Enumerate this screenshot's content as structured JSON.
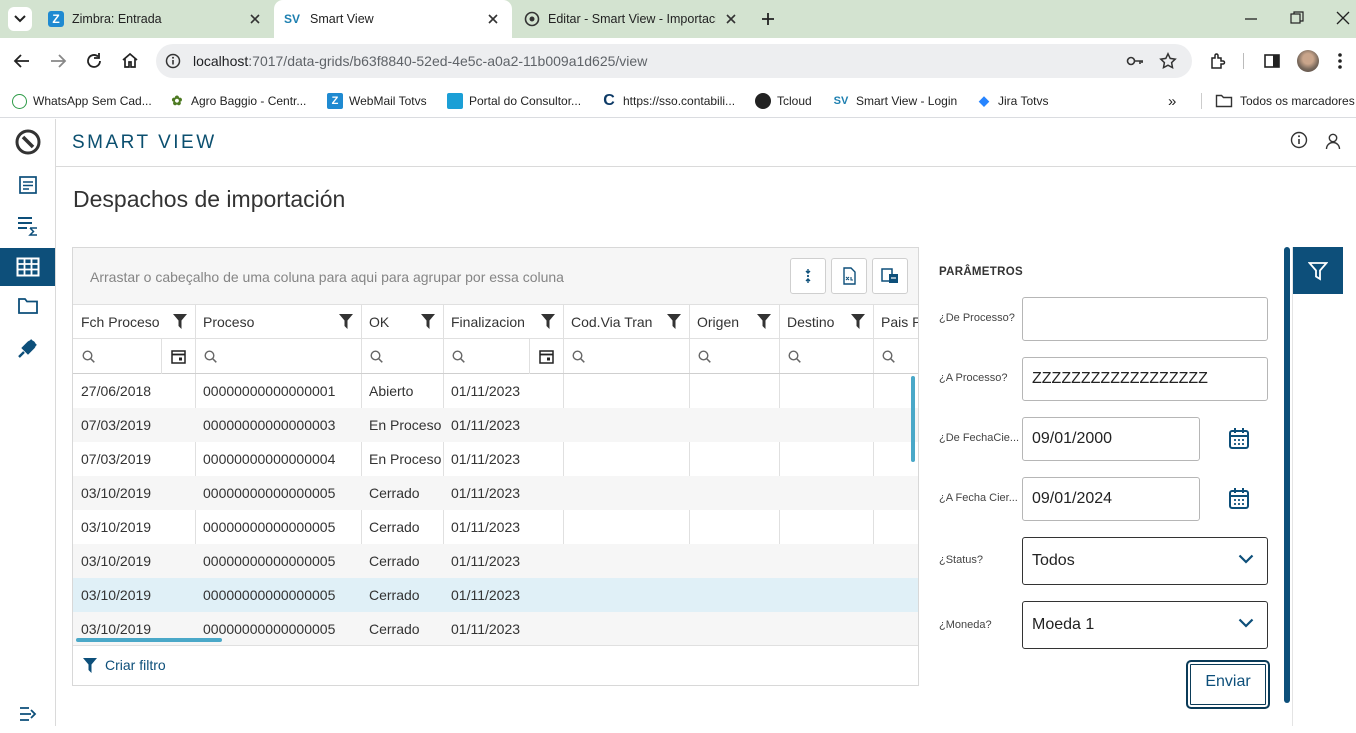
{
  "browser": {
    "tabs": [
      {
        "title": "Zimbra: Entrada",
        "icon": "zimbra-icon"
      },
      {
        "title": "Smart View",
        "icon": "sv-icon"
      },
      {
        "title": "Editar - Smart View - Importació",
        "icon": "globe-icon"
      }
    ],
    "url_host": "localhost",
    "url_path": ":7017/data-grids/b63f8840-52ed-4e5c-a0a2-11b009a1d625/view",
    "bookmarks": [
      "WhatsApp Sem Cad...",
      "Agro Baggio - Centr...",
      "WebMail Totvs",
      "Portal do Consultor...",
      "https://sso.contabili...",
      "Tcloud",
      "Smart View - Login",
      "Jira Totvs"
    ],
    "all_bookmarks": "Todos os marcadores"
  },
  "app": {
    "brand": "SMART VIEW",
    "page_title": "Despachos de importación",
    "accent_color": "#0d4f7a"
  },
  "grid": {
    "group_hint": "Arrastar o cabeçalho de uma coluna para aqui para agrupar por essa coluna",
    "columns": [
      "Fch Proceso",
      "Proceso",
      "OK",
      "Finalizacion",
      "Cod.Via Tran",
      "Origen",
      "Destino",
      "Pais P"
    ],
    "rows": [
      [
        "27/06/2018",
        "00000000000000001",
        "Abierto",
        "01/11/2023"
      ],
      [
        "07/03/2019",
        "00000000000000003",
        "En Proceso",
        "01/11/2023"
      ],
      [
        "07/03/2019",
        "00000000000000004",
        "En Proceso",
        "01/11/2023"
      ],
      [
        "03/10/2019",
        "00000000000000005",
        "Cerrado",
        "01/11/2023"
      ],
      [
        "03/10/2019",
        "00000000000000005",
        "Cerrado",
        "01/11/2023"
      ],
      [
        "03/10/2019",
        "00000000000000005",
        "Cerrado",
        "01/11/2023"
      ],
      [
        "03/10/2019",
        "00000000000000005",
        "Cerrado",
        "01/11/2023"
      ],
      [
        "03/10/2019",
        "00000000000000005",
        "Cerrado",
        "01/11/2023"
      ]
    ],
    "selected_row": 6,
    "create_filter": "Criar filtro"
  },
  "params": {
    "title": "PARÂMETROS",
    "de_processo_label": "¿De Processo?",
    "de_processo_value": "",
    "a_processo_label": "¿A Processo?",
    "a_processo_value": "ZZZZZZZZZZZZZZZZZZ",
    "de_fecha_label": "¿De FechaCie...",
    "de_fecha_value": "09/01/2000",
    "a_fecha_label": "¿A Fecha Cier...",
    "a_fecha_value": "09/01/2024",
    "status_label": "¿Status?",
    "status_value": "Todos",
    "moneda_label": "¿Moneda?",
    "moneda_value": "Moeda 1",
    "send_label": "Enviar"
  }
}
